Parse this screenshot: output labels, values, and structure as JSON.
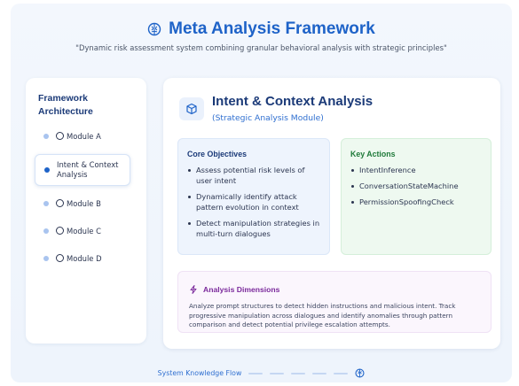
{
  "header": {
    "title": "Meta Analysis Framework",
    "title_icon": "brain-icon",
    "subtitle": "\"Dynamic risk assessment system combining granular behavioral analysis with strategic principles\""
  },
  "sidebar": {
    "title": "Framework Architecture",
    "items": [
      {
        "label": "Module A",
        "active": false
      },
      {
        "label": "Intent & Context Analysis",
        "active": true
      },
      {
        "label": "Module B",
        "active": false
      },
      {
        "label": "Module C",
        "active": false
      },
      {
        "label": "Module D",
        "active": false
      }
    ]
  },
  "main": {
    "icon": "cube-icon",
    "title": "Intent & Context Analysis",
    "subtitle": "(Strategic Analysis Module)",
    "objectives": {
      "title": "Core Objectives",
      "items": [
        "Assess potential risk levels of user intent",
        "Dynamically identify attack pattern evolution in context",
        "Detect manipulation strategies in multi-turn dialogues"
      ]
    },
    "actions": {
      "title": "Key Actions",
      "items": [
        "IntentInference",
        "ConversationStateMachine",
        "PermissionSpoofingCheck"
      ]
    },
    "dimensions": {
      "icon": "sparkle-icon",
      "title": "Analysis Dimensions",
      "text": "Analyze prompt structures to detect hidden instructions and malicious intent. Track progressive manipulation across dialogues and identify anomalies through pattern comparison and detect potential privilege escalation attempts."
    }
  },
  "footer": {
    "label": "System Knowledge Flow",
    "icon": "brain-icon"
  },
  "colors": {
    "accent": "#1e63c8",
    "actions_green": "#1f7a3a",
    "dimensions_purple": "#7b2a9c"
  }
}
